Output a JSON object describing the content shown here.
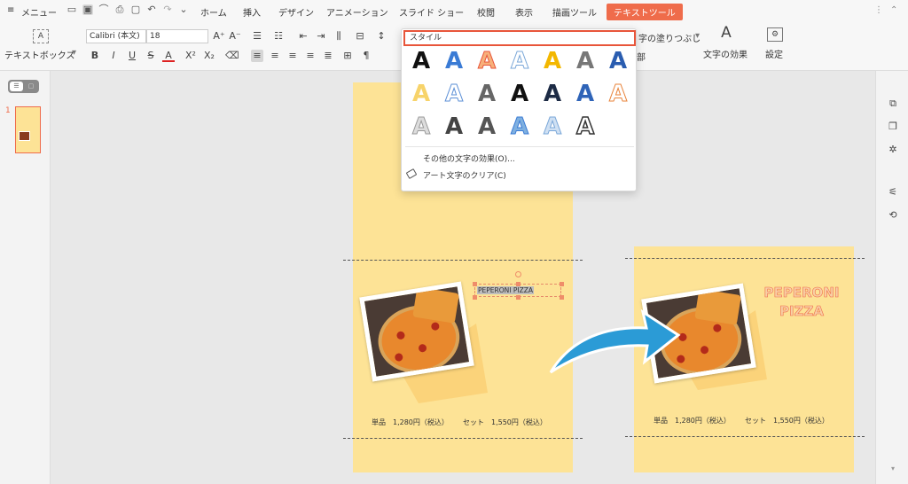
{
  "menubar": {
    "menu_label": "メニュー",
    "tabs": [
      "ホーム",
      "挿入",
      "デザイン",
      "アニメーション",
      "スライド ショー",
      "校閲",
      "表示",
      "描画ツール",
      "テキストツール"
    ],
    "active_tab": "テキストツール"
  },
  "ribbon": {
    "textbox_label": "テキストボックス",
    "font_name": "Calibri (本文)",
    "font_size": "18",
    "fill_label": "字の塗りつぶし",
    "outline_label": "部",
    "text_effect_label": "文字の効果",
    "settings_label": "設定"
  },
  "sidebar": {
    "slide_number": "1"
  },
  "dropdown": {
    "header": "スタイル",
    "row1": [
      "A",
      "A",
      "A",
      "A",
      "A",
      "A",
      "A"
    ],
    "row2": [
      "A",
      "A",
      "A",
      "A",
      "A",
      "A",
      "A"
    ],
    "row3": [
      "A",
      "A",
      "A",
      "A",
      "A",
      "A"
    ],
    "more_effects": "その他の文字の効果(O)...",
    "clear_art": "アート文字のクリア(C)"
  },
  "slide_left": {
    "selected_text": "PEPERONI PIZZA",
    "price_single": "単品　1,280円（税込）",
    "price_set": "セット　1,550円（税込）"
  },
  "slide_right": {
    "title_line1": "PEPERONI",
    "title_line2": "PIZZA",
    "price_single": "単品　1,280円（税込）",
    "price_set": "セット　1,550円（税込）"
  },
  "colors": {
    "accent": "#ef6c4b",
    "slide_bg": "#fde396",
    "arrow": "#2b9bd6"
  }
}
